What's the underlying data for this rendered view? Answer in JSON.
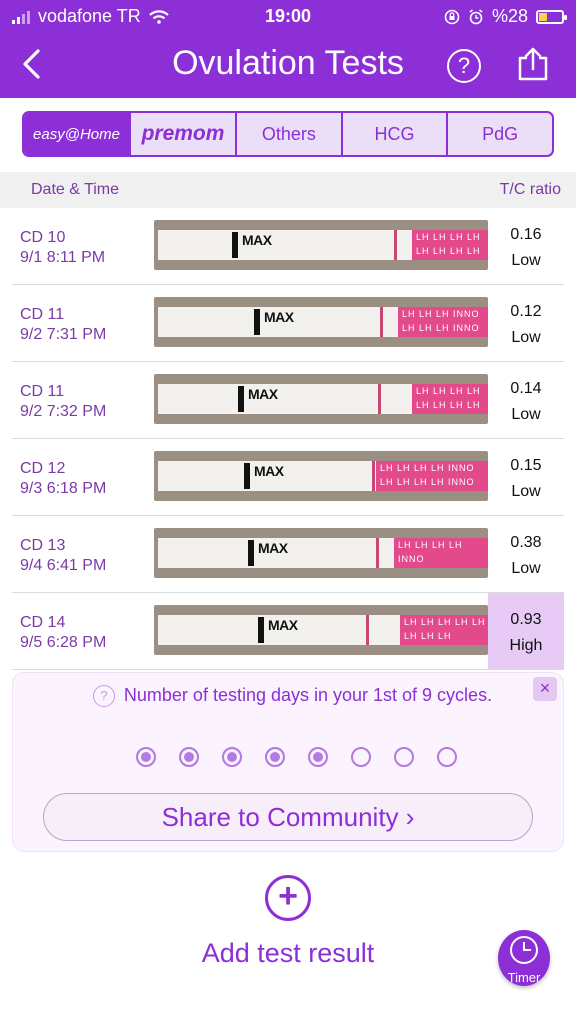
{
  "status_bar": {
    "carrier": "vodafone TR",
    "time": "19:00",
    "battery": "%28"
  },
  "header": {
    "title": "Ovulation Tests",
    "help_label": "?"
  },
  "tabs": [
    {
      "label": "easy@Home"
    },
    {
      "label": "premom"
    },
    {
      "label": "Others"
    },
    {
      "label": "HCG"
    },
    {
      "label": "PdG"
    }
  ],
  "table": {
    "col_date": "Date & Time",
    "col_ratio": "T/C ratio",
    "rows": [
      {
        "cd": "CD 10",
        "datetime": "9/1 8:11 PM",
        "ratio": "0.16",
        "level": "Low",
        "strip_text": "LH LH LH LH LH LH LH LH"
      },
      {
        "cd": "CD 11",
        "datetime": "9/2 7:31 PM",
        "ratio": "0.12",
        "level": "Low",
        "strip_text": "LH LH LH INNO LH LH LH INNO"
      },
      {
        "cd": "CD 11",
        "datetime": "9/2 7:32 PM",
        "ratio": "0.14",
        "level": "Low",
        "strip_text": "LH LH LH LH LH LH LH LH"
      },
      {
        "cd": "CD 12",
        "datetime": "9/3 6:18 PM",
        "ratio": "0.15",
        "level": "Low",
        "strip_text": "LH LH LH LH INNO LH LH LH LH INNO"
      },
      {
        "cd": "CD 13",
        "datetime": "9/4 6:41 PM",
        "ratio": "0.38",
        "level": "Low",
        "strip_text": "LH LH LH LH INNO"
      },
      {
        "cd": "CD 14",
        "datetime": "9/5 6:28 PM",
        "ratio": "0.93",
        "level": "High",
        "strip_text": "LH LH LH LH LH LH LH LH"
      }
    ],
    "max_label": "MAX"
  },
  "card": {
    "message": "Number of testing days in your 1st of 9 cycles.",
    "dots_filled": 5,
    "dots_total": 8,
    "share_label": "Share to Community ›",
    "close_label": "×"
  },
  "add": {
    "icon": "+",
    "label": "Add test result"
  },
  "timer": {
    "label": "Timer"
  },
  "colors": {
    "accent": "#8c2fd6",
    "high_bg": "#e7cbf6"
  }
}
